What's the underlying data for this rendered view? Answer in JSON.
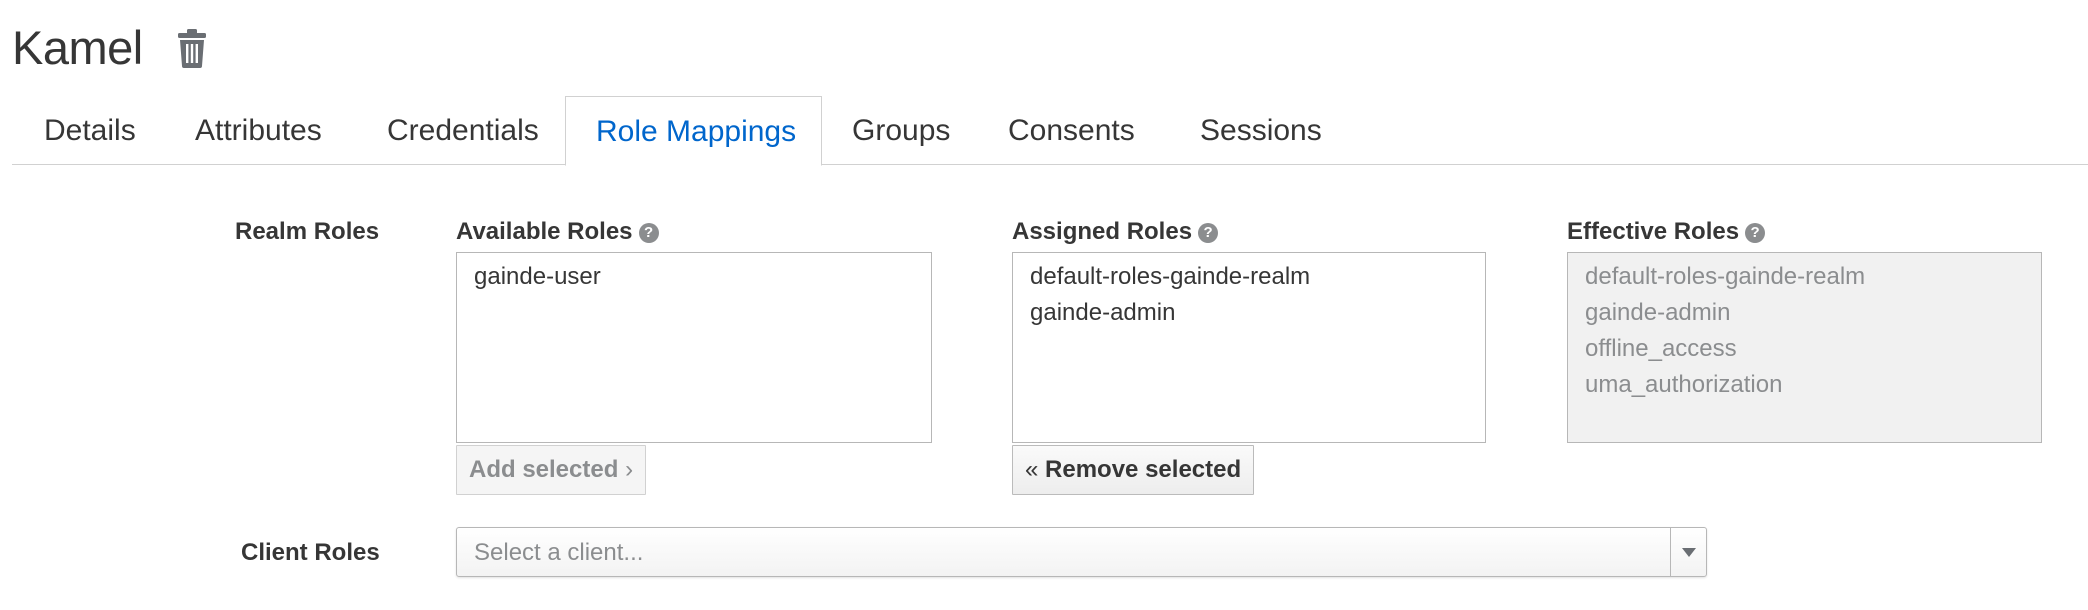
{
  "user": {
    "title": "Kamel"
  },
  "tabs": [
    {
      "label": "Details"
    },
    {
      "label": "Attributes"
    },
    {
      "label": "Credentials"
    },
    {
      "label": "Role Mappings"
    },
    {
      "label": "Groups"
    },
    {
      "label": "Consents"
    },
    {
      "label": "Sessions"
    }
  ],
  "active_tab": "Role Mappings",
  "realm_roles": {
    "label": "Realm Roles",
    "available": {
      "label": "Available Roles",
      "items": [
        "gainde-user"
      ],
      "button": "Add selected"
    },
    "assigned": {
      "label": "Assigned Roles",
      "items": [
        "default-roles-gainde-realm",
        "gainde-admin"
      ],
      "button": "Remove selected"
    },
    "effective": {
      "label": "Effective Roles",
      "items": [
        "default-roles-gainde-realm",
        "gainde-admin",
        "offline_access",
        "uma_authorization"
      ]
    }
  },
  "client_roles": {
    "label": "Client Roles",
    "placeholder": "Select a client..."
  },
  "colors": {
    "accent": "#0066cc",
    "border": "#d1d1d1"
  }
}
